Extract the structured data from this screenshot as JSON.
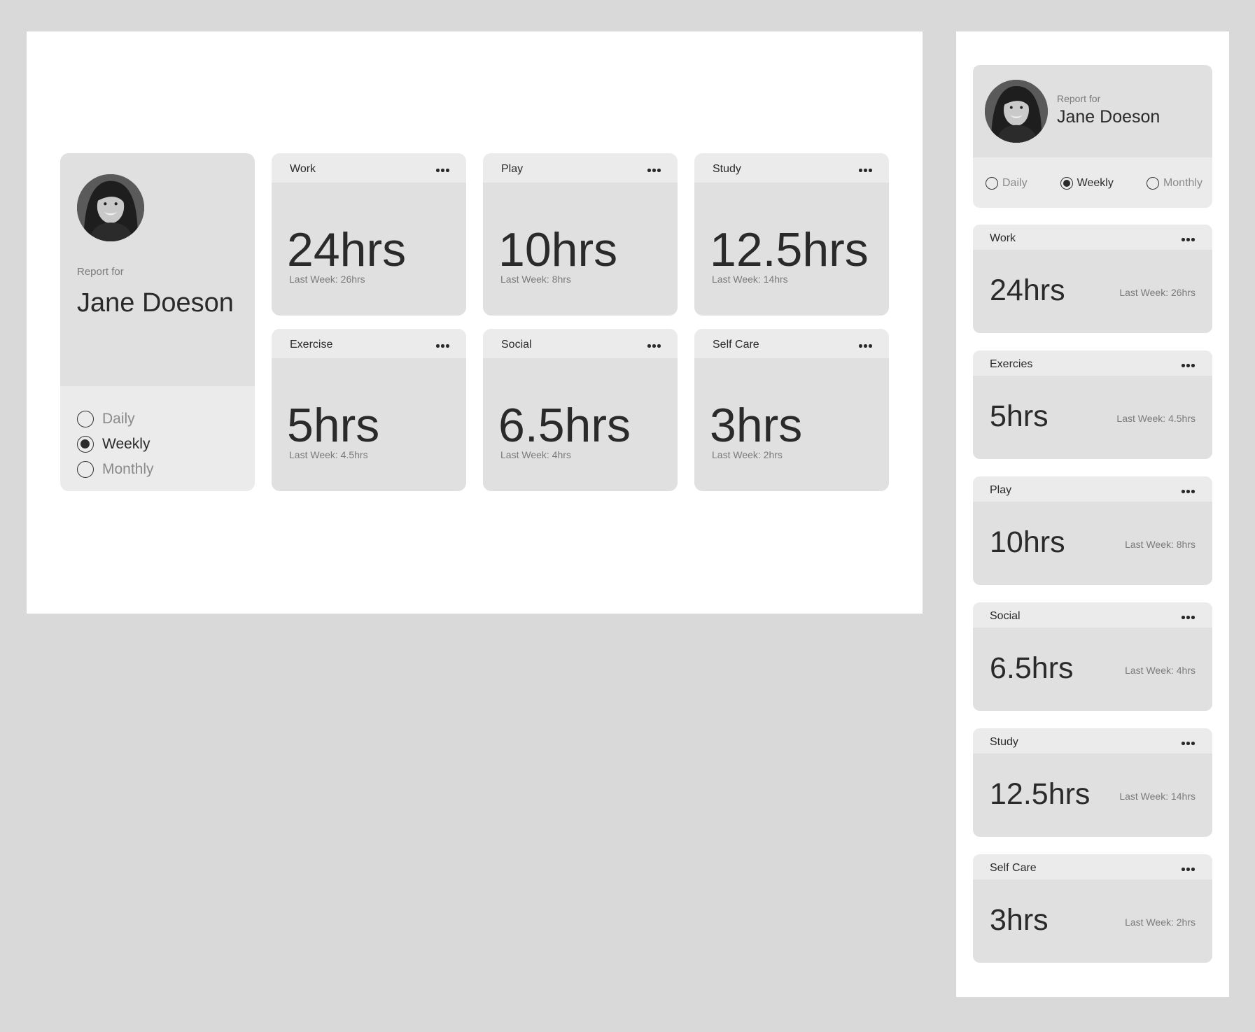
{
  "desktop": {
    "profile": {
      "report_label": "Report for",
      "name": "Jane Doeson",
      "periods": [
        {
          "label": "Daily",
          "selected": false
        },
        {
          "label": "Weekly",
          "selected": true
        },
        {
          "label": "Monthly",
          "selected": false
        }
      ]
    },
    "cards": [
      {
        "title": "Work",
        "value": "24hrs",
        "last": "Last Week: 26hrs"
      },
      {
        "title": "Play",
        "value": "10hrs",
        "last": "Last Week: 8hrs"
      },
      {
        "title": "Study",
        "value": "12.5hrs",
        "last": "Last Week: 14hrs"
      },
      {
        "title": "Exercise",
        "value": "5hrs",
        "last": "Last Week: 4.5hrs"
      },
      {
        "title": "Social",
        "value": "6.5hrs",
        "last": "Last Week: 4hrs"
      },
      {
        "title": "Self Care",
        "value": "3hrs",
        "last": "Last Week: 2hrs"
      }
    ]
  },
  "mobile": {
    "profile": {
      "report_label": "Report for",
      "name": "Jane Doeson",
      "periods": [
        {
          "label": "Daily",
          "selected": false
        },
        {
          "label": "Weekly",
          "selected": true
        },
        {
          "label": "Monthly",
          "selected": false
        }
      ]
    },
    "cards": [
      {
        "title": "Work",
        "value": "24hrs",
        "last": "Last Week: 26hrs"
      },
      {
        "title": "Exercies",
        "value": "5hrs",
        "last": "Last Week: 4.5hrs"
      },
      {
        "title": "Play",
        "value": "10hrs",
        "last": "Last Week: 8hrs"
      },
      {
        "title": "Social",
        "value": "6.5hrs",
        "last": "Last Week: 4hrs"
      },
      {
        "title": "Study",
        "value": "12.5hrs",
        "last": "Last Week: 14hrs"
      },
      {
        "title": "Self Care",
        "value": "3hrs",
        "last": "Last Week: 2hrs"
      }
    ]
  },
  "icons": {
    "more": "more-horizontal-icon",
    "avatar": "user-photo"
  },
  "colors": {
    "background": "#d9d9d9",
    "frame": "#ffffff",
    "card": "#e0e0e0",
    "card_header": "#ebebeb",
    "text": "#2a2a2a",
    "muted": "#7a7a7a"
  }
}
